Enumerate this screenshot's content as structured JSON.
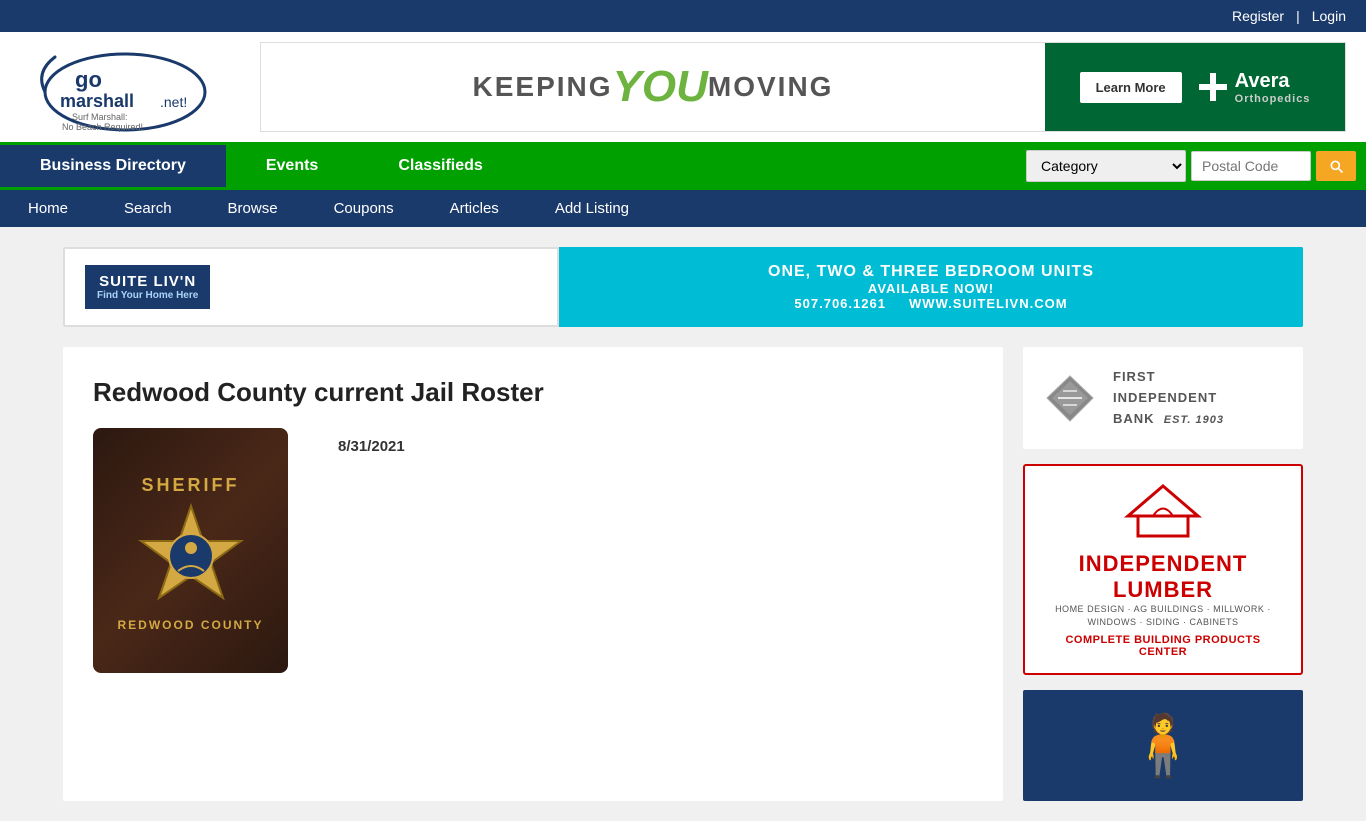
{
  "topbar": {
    "register": "Register",
    "divider": "|",
    "login": "Login"
  },
  "nav_green": {
    "items": [
      {
        "label": "Business Directory",
        "active": true
      },
      {
        "label": "Events",
        "active": false
      },
      {
        "label": "Classifieds",
        "active": false
      }
    ],
    "category_placeholder": "Category",
    "postal_placeholder": "Postal Code"
  },
  "nav_blue": {
    "items": [
      {
        "label": "Home"
      },
      {
        "label": "Search"
      },
      {
        "label": "Browse"
      },
      {
        "label": "Coupons"
      },
      {
        "label": "Articles"
      },
      {
        "label": "Add Listing"
      }
    ]
  },
  "banner": {
    "keeping": "KEEPING ",
    "you": "YOU",
    "moving": " MOVING",
    "learn_more": "Learn More",
    "avera": "Avera",
    "orthopedics": "Orthopedics"
  },
  "suite_banner": {
    "logo": "SUITE LIV'N",
    "find": "Find Your Home Here",
    "headline": "ONE, TWO & THREE BEDROOM UNITS",
    "available": "AVAILABLE NOW!",
    "phone": "507.706.1261",
    "website": "WWW.SUITELIVN.COM"
  },
  "article": {
    "title": "Redwood County current Jail Roster",
    "date": "8/31/2021",
    "sheriff_top": "SHERIFF",
    "sheriff_bottom": "REDWOOD COUNTY"
  },
  "sidebar": {
    "fi_bank": {
      "name": "FIRST",
      "name2": "INDEPENDENT",
      "name3": "BANK",
      "est": "Est. 1903"
    },
    "il": {
      "name": "INDEPENDENT LUMBER",
      "sub": "HOME DESIGN · AG BUILDINGS · MILLWORK · WINDOWS · SIDING · CABINETS",
      "tagline": "COMPLETE BUILDING PRODUCTS CENTER"
    }
  }
}
